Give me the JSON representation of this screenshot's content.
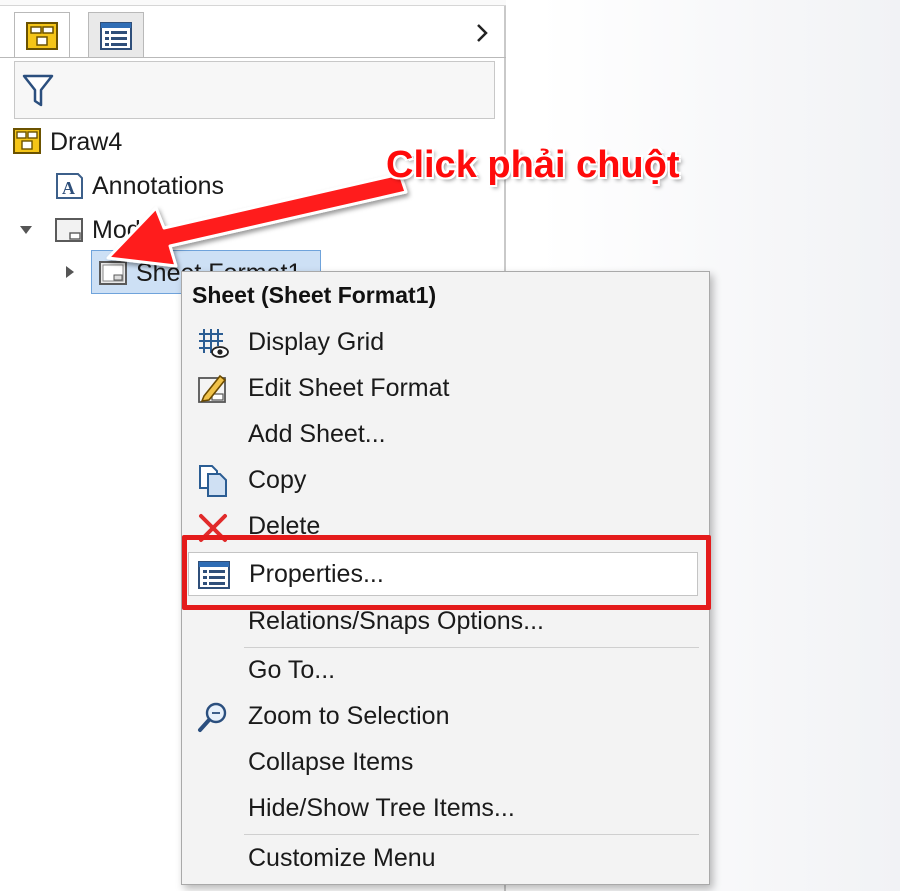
{
  "panel": {
    "tabs": [
      {
        "name": "feature-manager-tab",
        "icon": "feature-tree-icon",
        "active": true
      },
      {
        "name": "property-manager-tab",
        "icon": "property-list-icon",
        "active": false
      }
    ],
    "expand_icon": "chevron-right-icon",
    "filter_icon": "filter-icon"
  },
  "tree": {
    "root": {
      "label": "Draw4",
      "icon": "drawing-icon"
    },
    "items": [
      {
        "label": "Annotations",
        "icon": "annotations-icon"
      },
      {
        "label": "Mode",
        "icon": "sheet-icon",
        "expanded": true
      },
      {
        "label": "Sheet Format1",
        "icon": "sheet-format-icon",
        "selected": true
      }
    ]
  },
  "annotation": {
    "text": "Click phải chuột",
    "color": "#ff0a0a"
  },
  "context_menu": {
    "title": "Sheet (Sheet Format1)",
    "items": [
      {
        "label": "Display Grid",
        "icon": "display-grid-icon"
      },
      {
        "label": "Edit Sheet Format",
        "icon": "edit-sheet-format-icon"
      },
      {
        "label": "Add Sheet...",
        "icon": ""
      },
      {
        "label": "Copy",
        "icon": "copy-icon"
      },
      {
        "label": "Delete",
        "icon": "delete-icon"
      },
      {
        "label": "Properties...",
        "icon": "properties-icon",
        "highlighted": true
      },
      {
        "label": "Relations/Snaps Options...",
        "icon": ""
      },
      {
        "label": "Go To...",
        "icon": ""
      },
      {
        "label": "Zoom to Selection",
        "icon": "zoom-to-selection-icon"
      },
      {
        "label": "Collapse Items",
        "icon": ""
      },
      {
        "label": "Hide/Show Tree Items...",
        "icon": ""
      },
      {
        "label": "Customize Menu",
        "icon": ""
      }
    ]
  },
  "colors": {
    "highlight_box": "#e41b1b",
    "selection_bg": "#cde0f5",
    "menu_bg": "#f3f3f3"
  }
}
